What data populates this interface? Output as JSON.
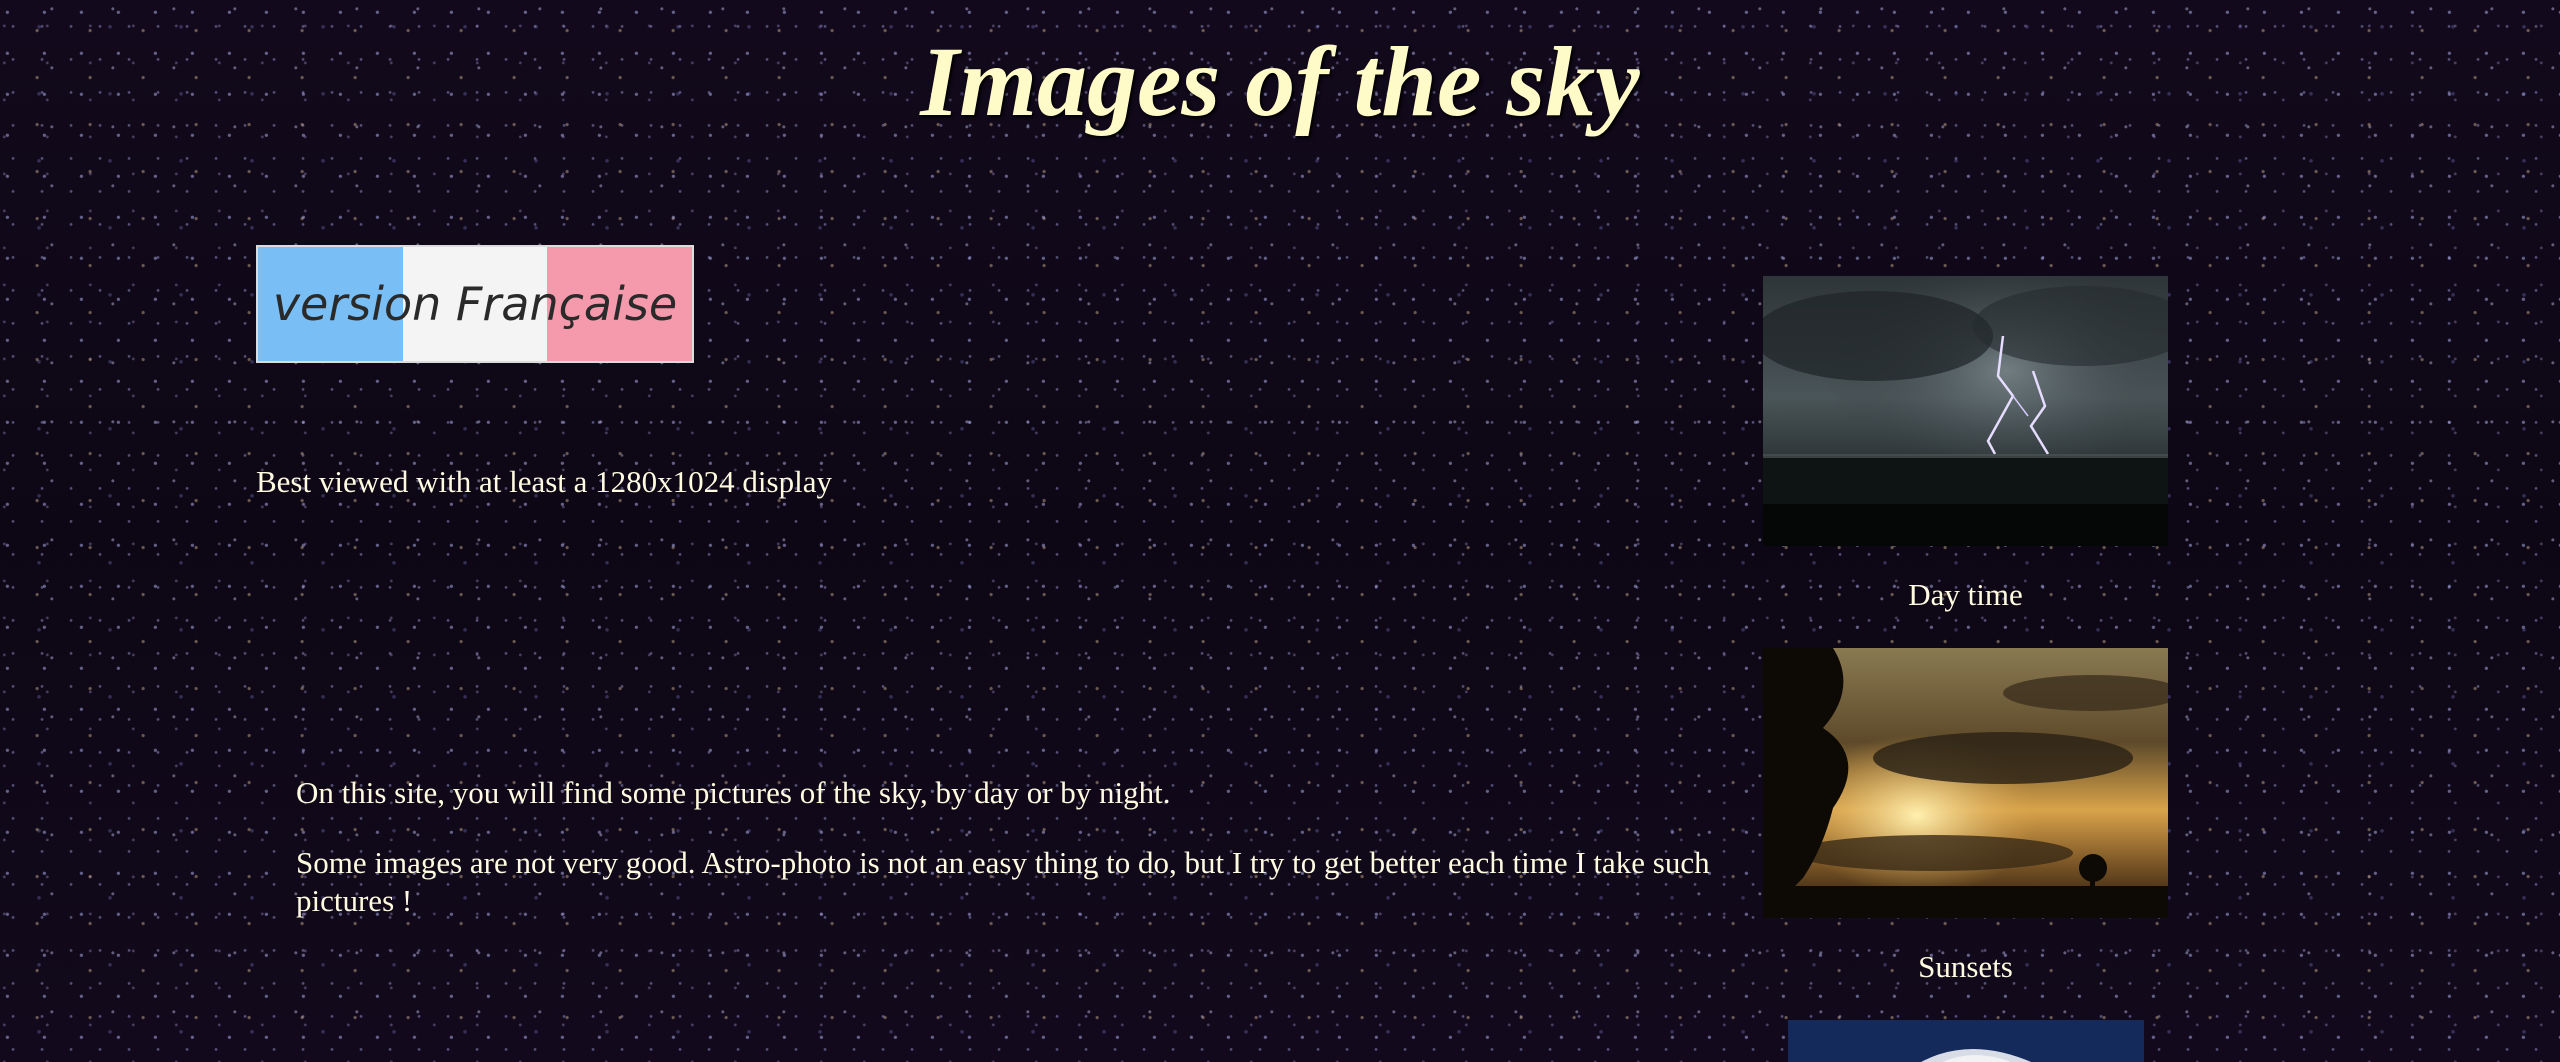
{
  "page": {
    "title": "Images of the sky",
    "background": "#0c0612",
    "text_color": "#fffbe0",
    "title_color": "#fffbc8"
  },
  "language_link": {
    "label": "version Française",
    "colors": [
      "#79bff5",
      "#f4f4f4",
      "#f59aad"
    ]
  },
  "display_note": "Best viewed with at least a 1280x1024 display",
  "intro": {
    "paragraphs": [
      "On this site, you will find some pictures of the sky, by day or by night.",
      "Some images are not very good. Astro-photo is not an easy thing to do, but I try to get better each time I take such pictures !"
    ]
  },
  "gallery": {
    "items": [
      {
        "caption": "Day time",
        "icon": "lightning-storm-photo"
      },
      {
        "caption": "Sunsets",
        "icon": "sunset-clouds-photo"
      },
      {
        "caption": "",
        "icon": "night-sky-photo"
      }
    ]
  }
}
